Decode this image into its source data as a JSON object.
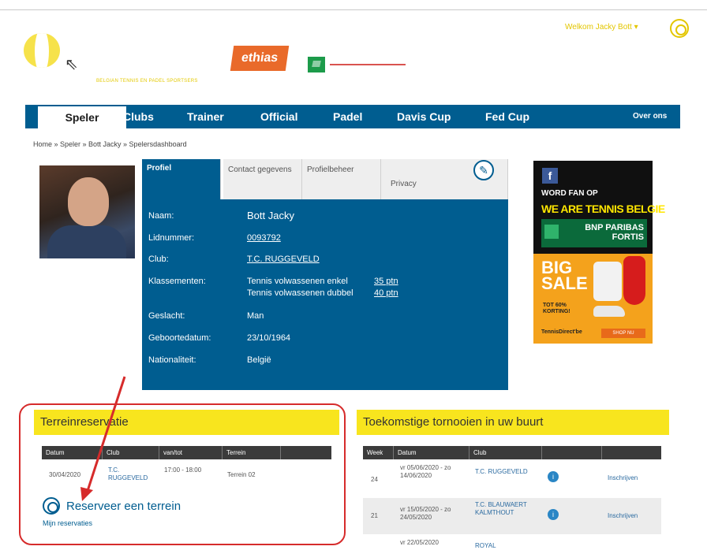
{
  "header": {
    "logo_tagline": "BELGIAN TENNIS EN PADEL SPORTSERS",
    "sponsor_ethias": "ethias",
    "welcome": "Welkom Jacky Bott ▾"
  },
  "nav": {
    "items": [
      "Speler",
      "Clubs",
      "Trainer",
      "Official",
      "Padel",
      "Davis Cup",
      "Fed Cup",
      "Over ons"
    ]
  },
  "breadcrumb": "Home » Speler » Bott Jacky » Spelersdashboard",
  "profile": {
    "tabs": [
      "Profiel",
      "Contact gegevens",
      "Profielbeheer",
      "Privacy"
    ],
    "rows": [
      {
        "label": "Naam:",
        "value": "Bott Jacky"
      },
      {
        "label": "Lidnummer:",
        "value": "0093792"
      },
      {
        "label": "Club:",
        "value": "T.C. RUGGEVELD"
      },
      {
        "label": "Klassementen:",
        "value": "Tennis volwassenen enkel",
        "value2": "Tennis volwassenen dubbel",
        "pts1": "35 ptn",
        "pts2": "40 ptn"
      },
      {
        "label": "Geslacht:",
        "value": "Man"
      },
      {
        "label": "Geboortedatum:",
        "value": "23/10/1964"
      },
      {
        "label": "Nationaliteit:",
        "value": "België"
      }
    ]
  },
  "ad": {
    "facebook": "f",
    "fan": "WORD FAN OP",
    "tagline": "WE ARE TENNIS BELGIE",
    "bnp": "BNP PARIBAS FORTIS",
    "big_sale": "BIG SALE",
    "korting": "TOT 60% KORTING!",
    "shop_logo": "TennisDirect'be",
    "shop_button": "SHOP NU"
  },
  "reservation": {
    "title": "Terreinreservatie",
    "columns": [
      "Datum",
      "Club",
      "van/tot",
      "Terrein"
    ],
    "rows": [
      {
        "datum": "30/04/2020",
        "club": "T.C. RUGGEVELD",
        "tijd": "17:00 - 18:00",
        "terrein": "Terrein 02"
      }
    ],
    "reserve_link": "Reserveer een terrein",
    "my_reservations": "Mijn reservaties"
  },
  "tournaments": {
    "title": "Toekomstige tornooien in uw buurt",
    "columns": [
      "Week",
      "Datum",
      "Club",
      "",
      ""
    ],
    "rows": [
      {
        "week": "24",
        "datum": "vr 05/06/2020 - zo 14/06/2020",
        "club": "T.C. RUGGEVELD",
        "action": "Inschrijven"
      },
      {
        "week": "21",
        "datum": "vr 15/05/2020 - zo 24/05/2020",
        "club": "T.C. BLAUWAERT KALMTHOUT",
        "action": "Inschrijven"
      },
      {
        "week": "",
        "datum": "vr 22/05/2020",
        "club": "ROYAL",
        "action": ""
      }
    ]
  }
}
